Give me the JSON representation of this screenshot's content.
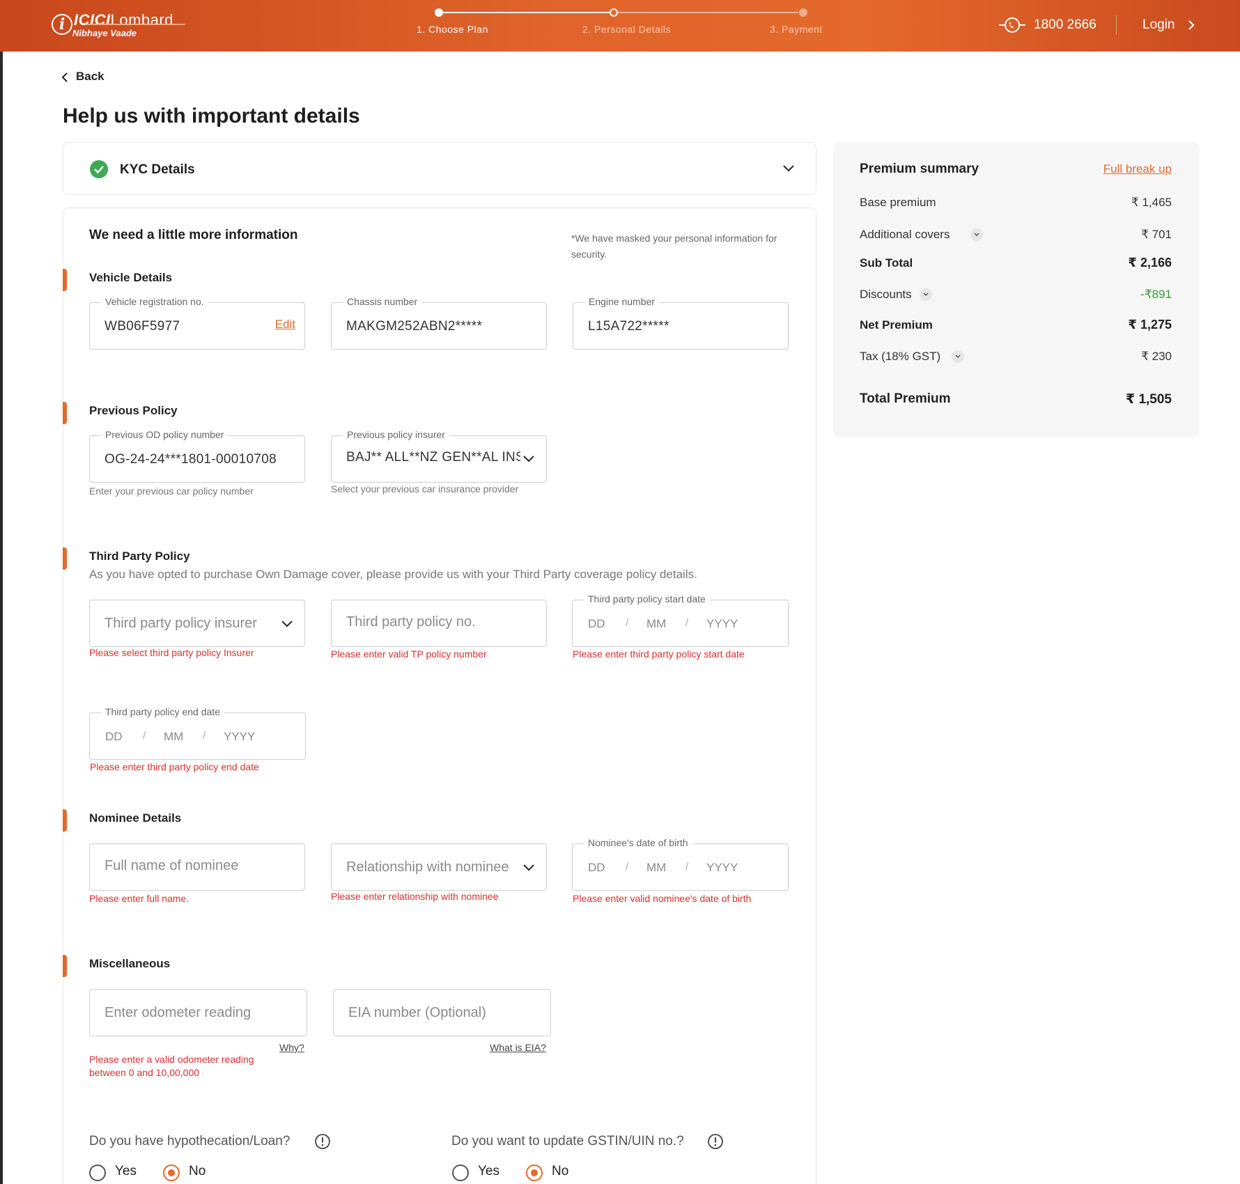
{
  "header": {
    "logo_brand": "ICICI",
    "logo_name": "Lombard",
    "logo_tagline": "Nibhaye Vaade",
    "steps": [
      {
        "label": "1. Choose Plan",
        "state": "done"
      },
      {
        "label": "2. Personal Details",
        "state": "current"
      },
      {
        "label": "3. Payment",
        "state": "todo"
      }
    ],
    "phone": "1800 2666",
    "login_label": "Login",
    "icons": {
      "phone": "phone-icon",
      "login": "chevron-right-icon"
    }
  },
  "nav": {
    "back_label": "Back"
  },
  "page": {
    "title": "Help us with important details"
  },
  "kyc": {
    "title": "KYC Details",
    "status_color": "#3ea857"
  },
  "form": {
    "title": "We need a little more information",
    "mask_note": "*We have masked your personal information for security.",
    "vehicle": {
      "title": "Vehicle Details",
      "registration": {
        "label": "Vehicle registration no.",
        "value": "WB06F5977",
        "edit": "Edit"
      },
      "chassis": {
        "label": "Chassis number",
        "value": "MAKGM252ABN2*****"
      },
      "engine": {
        "label": "Engine number",
        "value": "L15A722*****"
      }
    },
    "previous_policy": {
      "title": "Previous Policy",
      "od_number": {
        "label": "Previous OD policy number",
        "value": "OG-24-24***1801-00010708",
        "helper": "Enter your previous car policy number"
      },
      "insurer": {
        "label": "Previous policy insurer",
        "value": "BAJ** ALL**NZ GEN**AL INSURANCE",
        "helper": "Select your previous car insurance provider"
      }
    },
    "third_party": {
      "title": "Third Party Policy",
      "description": "As you have opted to purchase Own Damage cover, please provide us with your Third Party coverage policy details.",
      "insurer": {
        "placeholder": "Third party policy insurer",
        "error": "Please select third party policy Insurer"
      },
      "policy_no": {
        "placeholder": "Third party policy no.",
        "error": "Please enter valid TP policy number"
      },
      "start_date": {
        "label": "Third party policy start date",
        "dd": "DD",
        "mm": "MM",
        "yyyy": "YYYY",
        "sep": "/",
        "error": "Please enter third party policy start date"
      },
      "end_date": {
        "label": "Third party policy end date",
        "dd": "DD",
        "mm": "MM",
        "yyyy": "YYYY",
        "sep": "/",
        "error": "Please enter third party policy end date"
      }
    },
    "nominee": {
      "title": "Nominee Details",
      "name": {
        "placeholder": "Full name of nominee",
        "error": "Please enter full name."
      },
      "relationship": {
        "placeholder": "Relationship with nominee",
        "error": "Please enter relationship with nominee"
      },
      "dob": {
        "label": "Nominee's date of birth",
        "dd": "DD",
        "mm": "MM",
        "yyyy": "YYYY",
        "sep": "/",
        "error": "Please enter valid nominee's date of birth"
      }
    },
    "misc": {
      "title": "Miscellaneous",
      "odometer": {
        "placeholder": "Enter odometer reading",
        "link": "Why?",
        "error_line1": "Please enter a valid odometer reading",
        "error_line2": "between 0 and 10,00,000"
      },
      "eia": {
        "placeholder": "EIA number (Optional)",
        "link": "What is EIA?"
      }
    },
    "hypothecation": {
      "question": "Do you have hypothecation/Loan?",
      "yes": "Yes",
      "no": "No",
      "selected": "No"
    },
    "gstin": {
      "question": "Do you want to update GSTIN/UIN no.?",
      "yes": "Yes",
      "no": "No",
      "selected": "No"
    }
  },
  "summary": {
    "title": "Premium summary",
    "full_breakup": "Full break up",
    "rows": [
      {
        "label": "Base premium",
        "value": "₹ 1,465"
      },
      {
        "label": "Additional covers",
        "value": "₹ 701"
      },
      {
        "label": "Sub Total",
        "value": "₹ 2,166"
      },
      {
        "label": "Discounts",
        "value": "-₹891"
      },
      {
        "label": "Net Premium",
        "value": "₹ 1,275"
      },
      {
        "label": "Tax (18% GST)",
        "value": "₹ 230"
      }
    ],
    "total_label": "Total Premium",
    "total_value": "₹ 1,505"
  },
  "colors": {
    "brand": "#e4692c",
    "error": "#e02e2e",
    "discount": "#3a9a3a"
  }
}
